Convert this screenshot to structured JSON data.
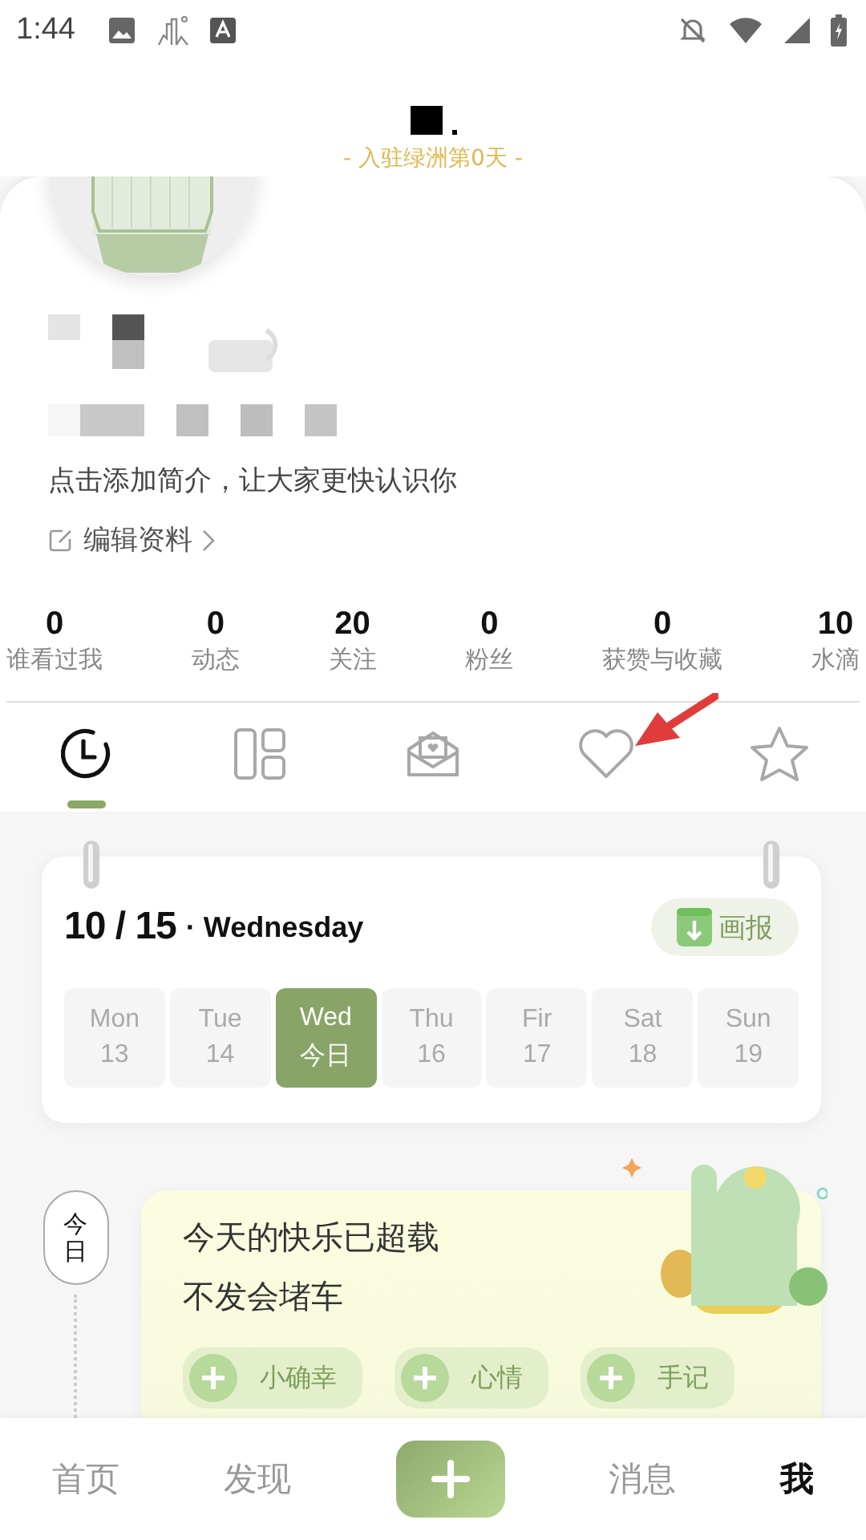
{
  "status_bar": {
    "time": "1:44"
  },
  "header": {
    "subtitle": "- 入驻绿洲第0天 -"
  },
  "profile": {
    "bio": "点击添加简介，让大家更快认识你",
    "edit_link": "编辑资料"
  },
  "stats": [
    {
      "value": "0",
      "label": "谁看过我"
    },
    {
      "value": "0",
      "label": "动态"
    },
    {
      "value": "20",
      "label": "关注"
    },
    {
      "value": "0",
      "label": "粉丝"
    },
    {
      "value": "0",
      "label": "获赞与收藏"
    },
    {
      "value": "10",
      "label": "水滴"
    }
  ],
  "tabs": [
    {
      "kind": "clock",
      "selected": true
    },
    {
      "kind": "layout",
      "selected": false
    },
    {
      "kind": "envelope",
      "selected": false
    },
    {
      "kind": "heart",
      "selected": false
    },
    {
      "kind": "star",
      "selected": false
    }
  ],
  "calendar": {
    "date": "10 / 15",
    "weekday": "· Wednesday",
    "poster_button": "画报",
    "days": [
      {
        "name": "Mon",
        "date": "13",
        "selected": false
      },
      {
        "name": "Tue",
        "date": "14",
        "selected": false
      },
      {
        "name": "Wed",
        "date": "今日",
        "selected": true
      },
      {
        "name": "Thu",
        "date": "16",
        "selected": false
      },
      {
        "name": "Fir",
        "date": "17",
        "selected": false
      },
      {
        "name": "Sat",
        "date": "18",
        "selected": false
      },
      {
        "name": "Sun",
        "date": "19",
        "selected": false
      }
    ]
  },
  "timeline": {
    "marker": "今日"
  },
  "mood_card": {
    "lines": [
      "今天的快乐已超载",
      "不发会堵车"
    ],
    "actions": [
      "小确幸",
      "心情",
      "手记"
    ]
  },
  "nav": [
    {
      "kind": "text",
      "label": "首页",
      "selected": false
    },
    {
      "kind": "text",
      "label": "发现",
      "selected": false
    },
    {
      "kind": "add"
    },
    {
      "kind": "text",
      "label": "消息",
      "selected": false
    },
    {
      "kind": "text",
      "label": "我",
      "selected": true
    }
  ]
}
